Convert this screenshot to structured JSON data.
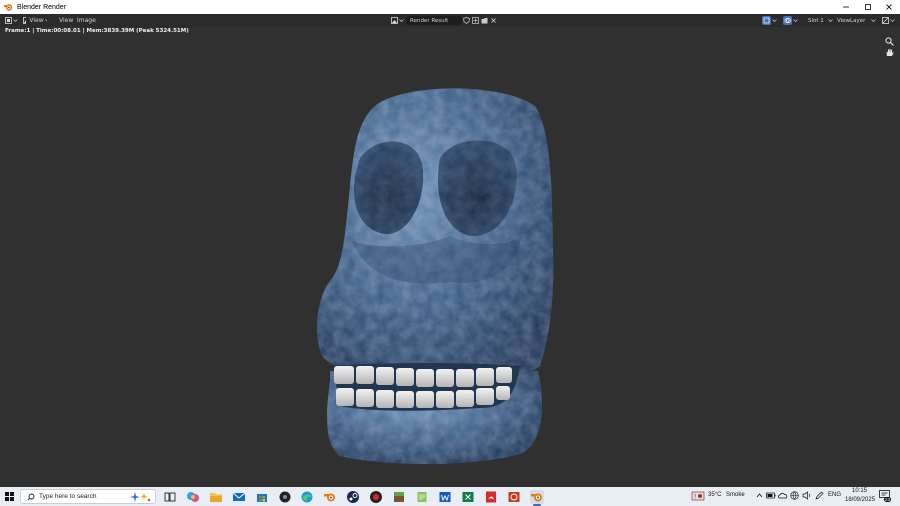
{
  "window": {
    "title": "Blender Render"
  },
  "header": {
    "menus": [
      "View",
      "View",
      "Image"
    ],
    "image_name": "Render Result",
    "slot": "Slot 1",
    "view_layer": "ViewLayer"
  },
  "info": {
    "stats": "Frame:1 | Time:00:08.01 | Mem:3839.39M (Peak 5324.51M)"
  },
  "taskbar": {
    "search_placeholder": "Type here to search",
    "weather_temp": "35°C",
    "weather_text": "Smoke",
    "language": "ENG",
    "time": "10:15",
    "date": "18/09/2025",
    "notification_count": "23"
  },
  "colors": {
    "accent": "#e87d0d",
    "viewport_bg": "#303030",
    "skull_blue": "#4a6d94"
  }
}
